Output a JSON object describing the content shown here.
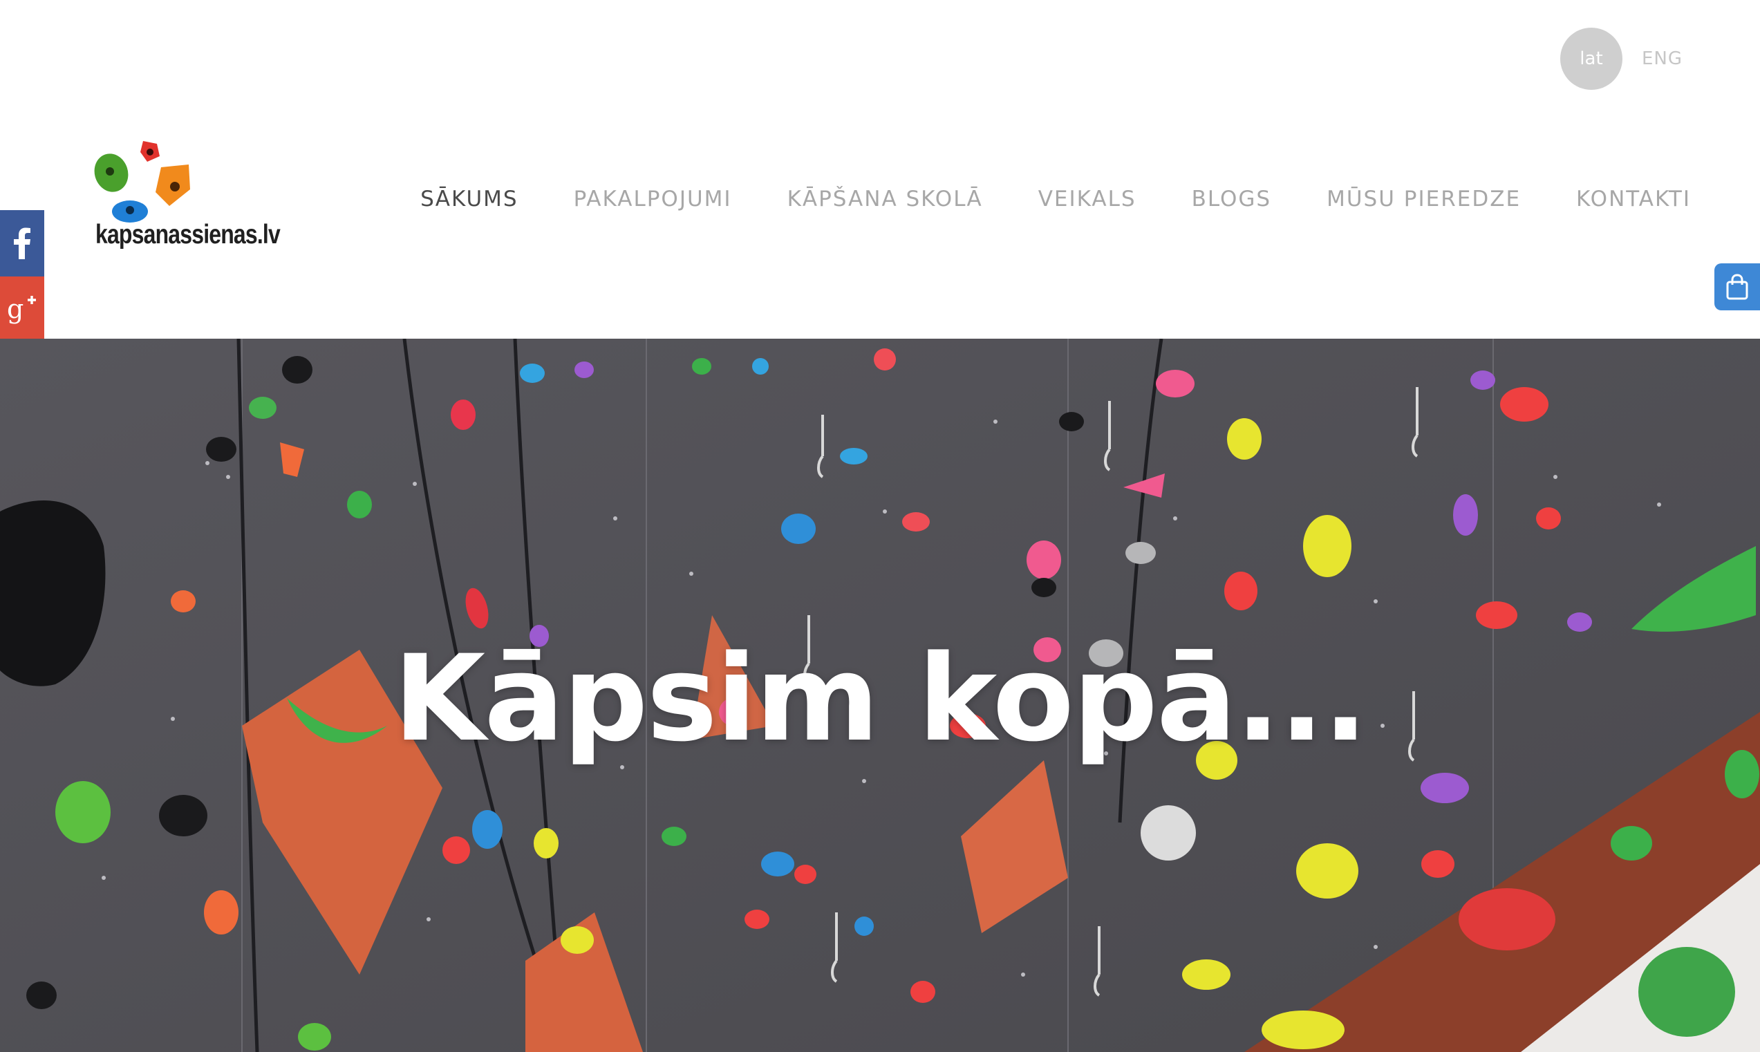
{
  "brand": {
    "logo_text": "kapsanassienas.lv"
  },
  "language": {
    "active": "lat",
    "other": "ENG"
  },
  "nav": {
    "items": [
      {
        "label": "SĀKUMS",
        "active": true
      },
      {
        "label": "PAKALPOJUMI",
        "active": false
      },
      {
        "label": "KĀPŠANA SKOLĀ",
        "active": false
      },
      {
        "label": "VEIKALS",
        "active": false
      },
      {
        "label": "BLOGS",
        "active": false
      },
      {
        "label": "MŪSU PIEREDZE",
        "active": false
      },
      {
        "label": "KONTAKTI",
        "active": false
      }
    ]
  },
  "social": {
    "buttons": [
      {
        "icon": "facebook-icon",
        "color": "#3b5998"
      },
      {
        "icon": "google-plus-icon",
        "color": "#dd4b39"
      },
      {
        "icon": "draugiem-icon",
        "color": "#f58b2c"
      }
    ]
  },
  "cart": {
    "icon": "shopping-bag-icon",
    "color": "#3e88d6"
  },
  "hero": {
    "title": "Kāpsim kopā..."
  },
  "colors": {
    "nav_active": "#4a4a4a",
    "nav_inactive": "#a7a7a7",
    "wall": "#5b5a5f"
  }
}
